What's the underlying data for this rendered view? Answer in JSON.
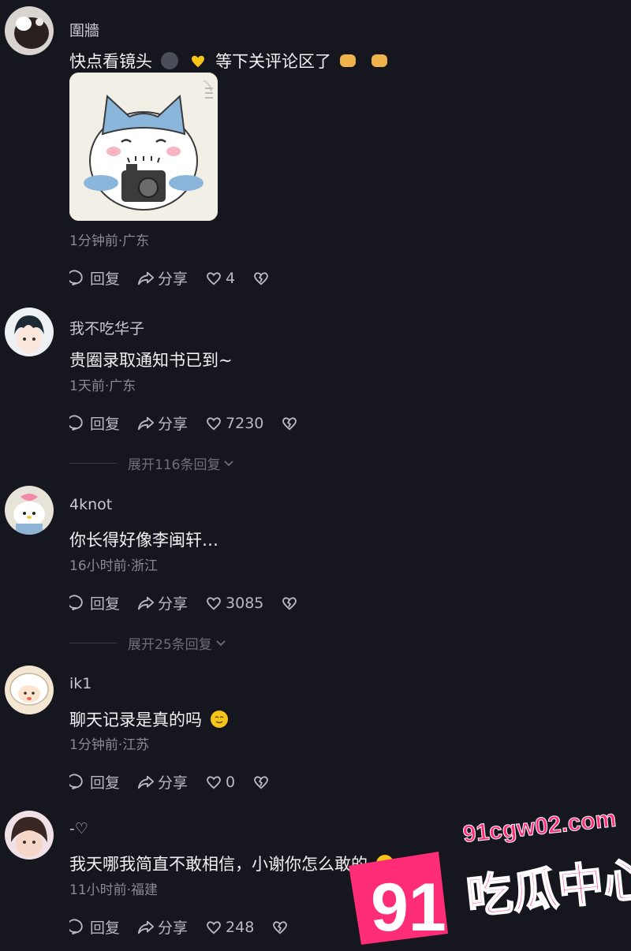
{
  "comments": [
    {
      "username": "圍牆",
      "text": "快点看镜头",
      "text_suffix": "等下关评论区了",
      "meta": "1分钟前·广东",
      "reply": "回复",
      "share": "分享",
      "likes": "4"
    },
    {
      "username": "我不吃华子",
      "text": "贵圈录取通知书已到~",
      "meta": "1天前·广东",
      "reply": "回复",
      "share": "分享",
      "likes": "7230",
      "expand": "展开116条回复"
    },
    {
      "username": "4knot",
      "text": "你长得好像李闽轩…",
      "meta": "16小时前·浙江",
      "reply": "回复",
      "share": "分享",
      "likes": "3085",
      "expand": "展开25条回复"
    },
    {
      "username": "ik1",
      "text": "聊天记录是真的吗",
      "meta": "1分钟前·江苏",
      "reply": "回复",
      "share": "分享",
      "likes": "0"
    },
    {
      "username": "-♡",
      "text": "我天哪我简直不敢相信，小谢你怎么敢的",
      "meta": "11小时前·福建",
      "reply": "回复",
      "share": "分享",
      "likes": "248"
    }
  ],
  "watermark": {
    "number": "91",
    "site": "91cgw02.com",
    "label": "吃瓜中心"
  },
  "colors": {
    "background": "#16161f",
    "watermark_pink": "#ff2d78"
  }
}
